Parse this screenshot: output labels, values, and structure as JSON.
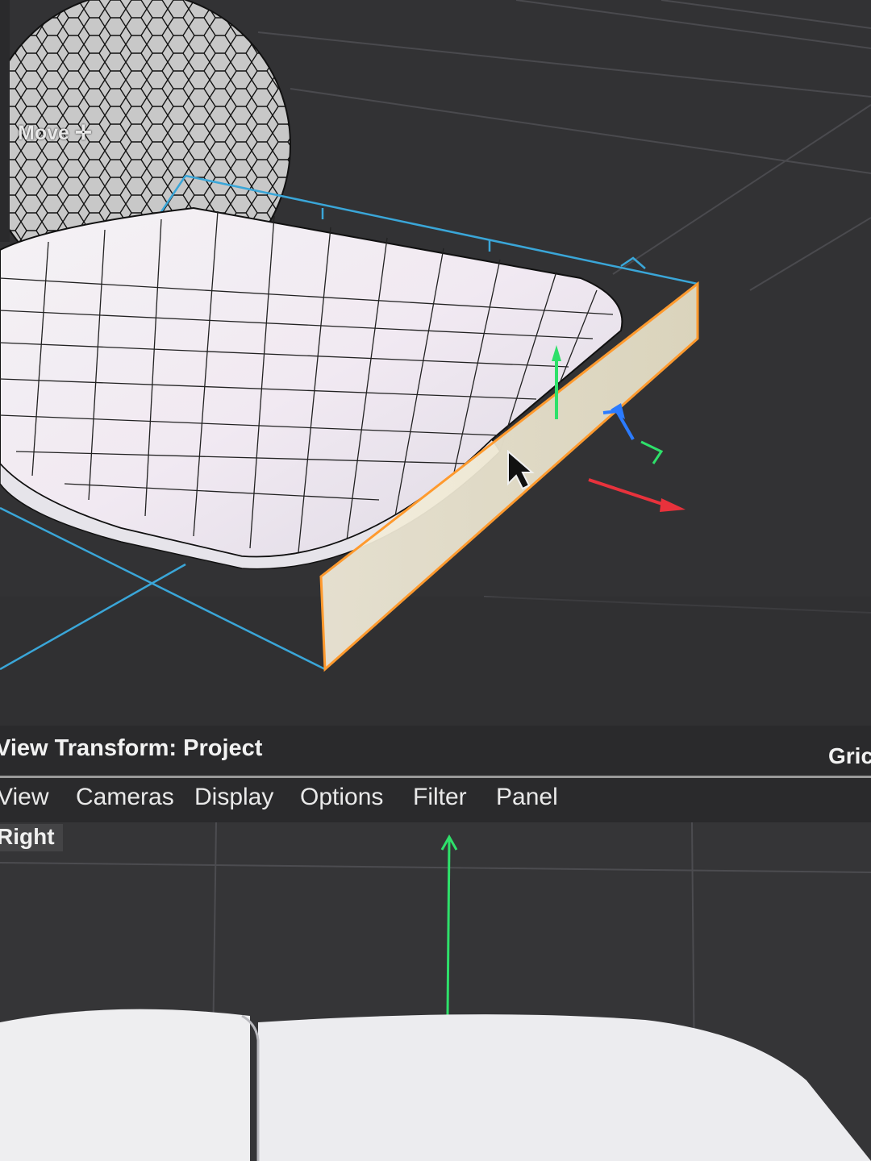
{
  "viewport_top": {
    "tool_label": "Move ✛"
  },
  "status": {
    "view_transform": "View Transform: Project",
    "right_label": "Gric"
  },
  "menu": {
    "items": [
      {
        "label": "View"
      },
      {
        "label": "Cameras"
      },
      {
        "label": "Display"
      },
      {
        "label": "Options"
      },
      {
        "label": "Filter"
      },
      {
        "label": "Panel"
      }
    ]
  },
  "viewport_bottom": {
    "camera_label": "Right"
  },
  "colors": {
    "selection_outline": "#ff9a2e",
    "bounding_box": "#3aa6d8",
    "axis_x": "#e8323c",
    "axis_y": "#2ee06a",
    "axis_z": "#2b7bff"
  },
  "icons": {
    "move": "move-icon",
    "cursor": "mouse-cursor-icon"
  }
}
